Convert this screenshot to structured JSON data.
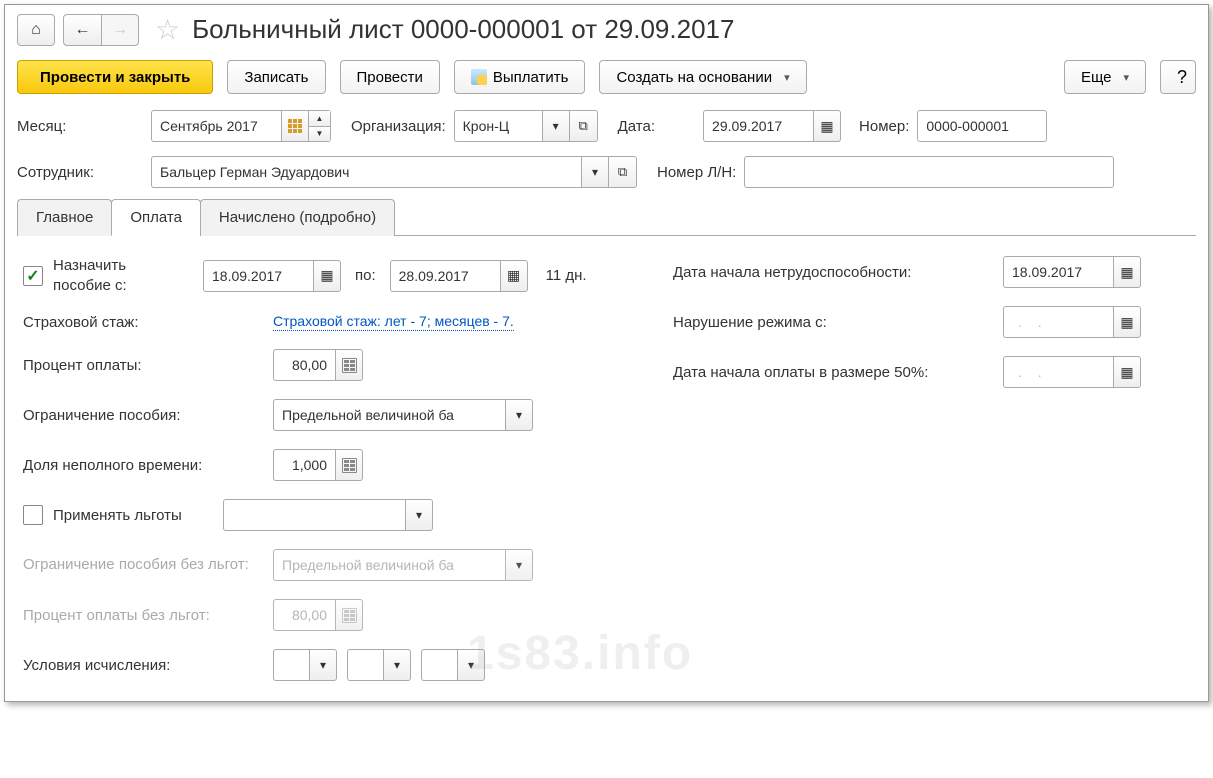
{
  "header": {
    "title": "Больничный лист 0000-000001 от 29.09.2017"
  },
  "toolbar": {
    "post_close": "Провести и закрыть",
    "write": "Записать",
    "post": "Провести",
    "pay": "Выплатить",
    "create_based": "Создать на основании",
    "more": "Еще",
    "help": "?"
  },
  "row1": {
    "month_lbl": "Месяц:",
    "month_val": "Сентябрь 2017",
    "org_lbl": "Организация:",
    "org_val": "Крон-Ц",
    "date_lbl": "Дата:",
    "date_val": "29.09.2017",
    "num_lbl": "Номер:",
    "num_val": "0000-000001"
  },
  "row2": {
    "emp_lbl": "Сотрудник:",
    "emp_val": "Бальцер Герман Эдуардович",
    "ln_lbl": "Номер Л/Н:"
  },
  "tabs": {
    "main": "Главное",
    "payment": "Оплата",
    "accrued": "Начислено (подробно)"
  },
  "pane": {
    "assign": "Назначить пособие с:",
    "from": "18.09.2017",
    "to_lbl": "по:",
    "to": "28.09.2017",
    "days": "11 дн.",
    "stage_lbl": "Страховой стаж:",
    "stage_link": "Страховой стаж: лет - 7;  месяцев - 7.",
    "percent_lbl": "Процент оплаты:",
    "percent_val": "80,00",
    "limit_lbl": "Ограничение пособия:",
    "limit_val": "Предельной величиной ба",
    "part_lbl": "Доля неполного времени:",
    "part_val": "1,000",
    "benefits_lbl": "Применять льготы",
    "limit_no_lbl": "Ограничение пособия без льгот:",
    "limit_no_val": "Предельной величиной ба",
    "percent_no_lbl": "Процент оплаты без льгот:",
    "percent_no_val": "80,00",
    "cond_lbl": "Условия исчисления:",
    "disab_start_lbl": "Дата начала нетрудоспособности:",
    "disab_start_val": "18.09.2017",
    "violation_lbl": "Нарушение режима с:",
    "violation_val": ". .",
    "half_lbl": "Дата начала оплаты в размере 50%:",
    "half_val": ". .",
    "watermark": "1s83.info"
  }
}
